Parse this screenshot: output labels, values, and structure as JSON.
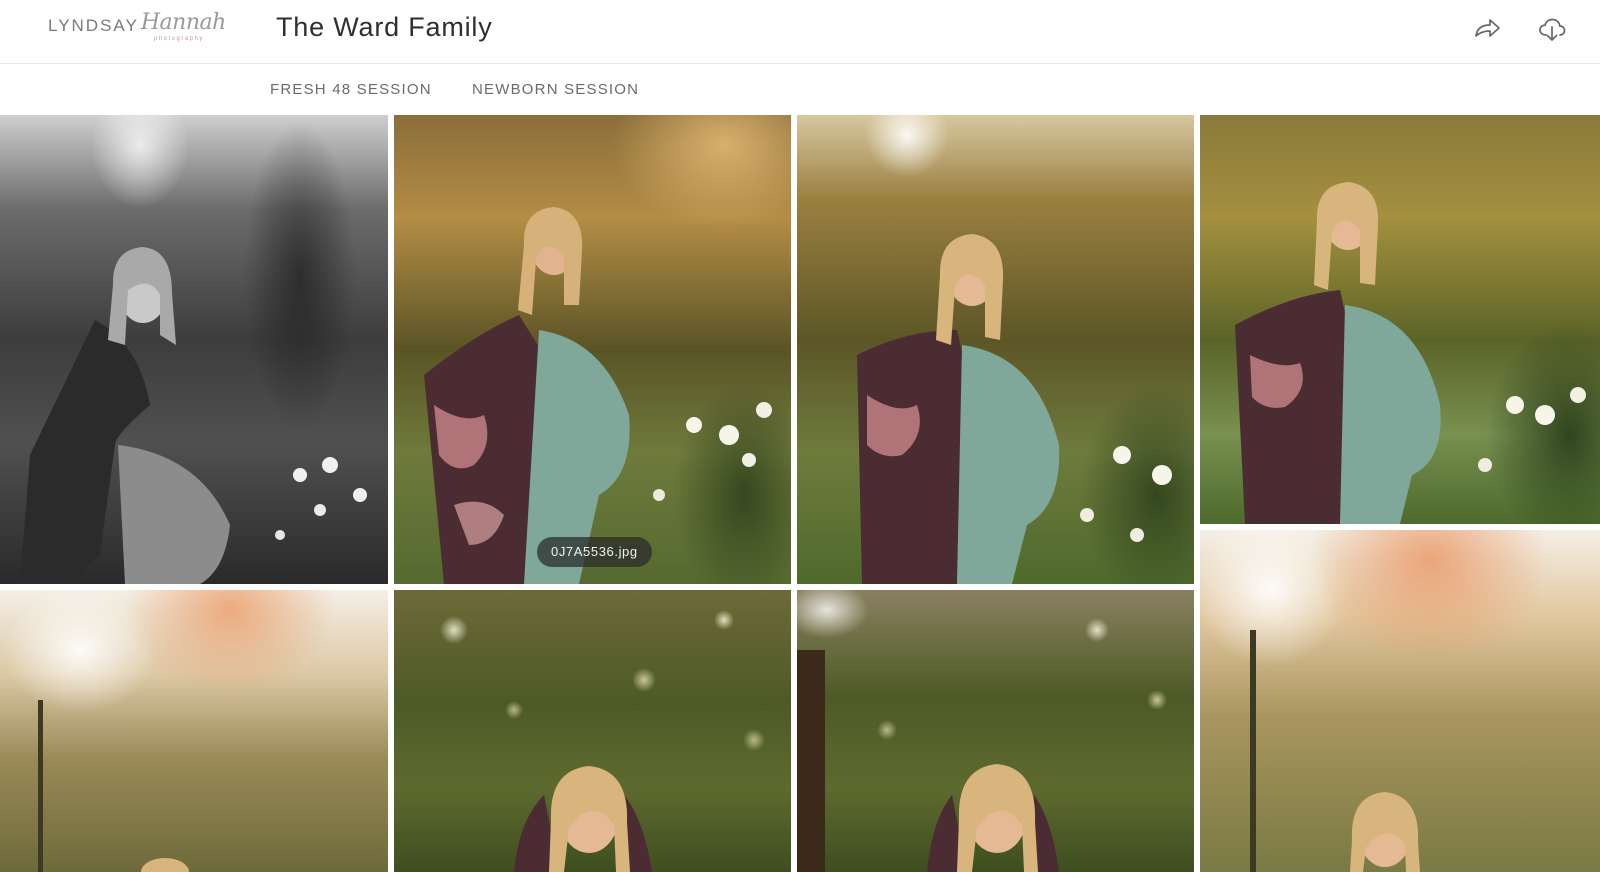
{
  "brand": {
    "name_word": "LYNDSAY",
    "name_script": "Hannah",
    "name_sub": "photography"
  },
  "gallery": {
    "title": "The Ward Family"
  },
  "actions": {
    "share_icon": "share-arrow-icon",
    "download_icon": "cloud-download-icon"
  },
  "tabs": [
    {
      "label": "FRESH 48 SESSION"
    },
    {
      "label": "NEWBORN SESSION"
    }
  ],
  "photos": [
    {
      "tone": "bw"
    },
    {
      "tone": "warm"
    },
    {
      "tone": "warm"
    },
    {
      "tone": "warm"
    },
    {
      "tone": "haze"
    },
    {
      "tone": "green"
    },
    {
      "tone": "green"
    },
    {
      "tone": "haze"
    }
  ],
  "hover_tooltip": {
    "filename": "0J7A5536.jpg"
  },
  "colors": {
    "dress": "#7fa89a",
    "foliage": "#5b6a2e",
    "sunlight": "#e9c98c",
    "header_text": "#2f2f2f"
  }
}
